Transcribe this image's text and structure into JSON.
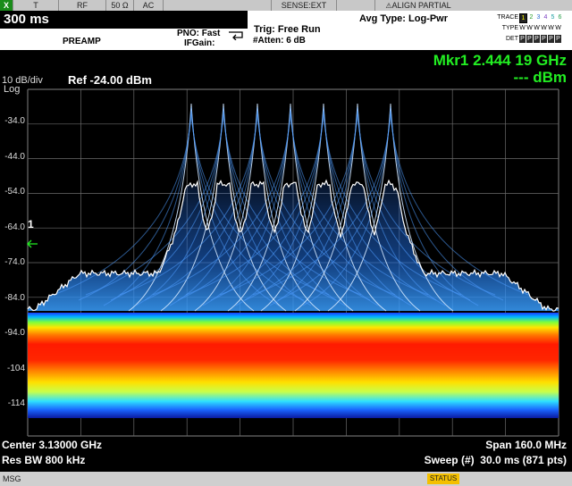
{
  "statusbar": {
    "x_label": "X",
    "t_label": "T",
    "rf_label": "RF",
    "impedance": "50 Ω",
    "coupling": "AC",
    "sense": "SENSE:EXT",
    "align": "ALIGN PARTIAL"
  },
  "header": {
    "sweep_time": "300 ms",
    "preamp": "PREAMP",
    "pno": "PNO: Fast",
    "ifgain": "IFGain:",
    "trig": "Trig: Free Run",
    "atten": "#Atten: 6 dB",
    "avg_type": "Avg Type: Log-Pwr"
  },
  "trace_panel": {
    "trace_label": "TRACE",
    "type_label": "TYPE",
    "det_label": "DET",
    "traces": [
      "1",
      "2",
      "3",
      "4",
      "5",
      "6"
    ],
    "types": [
      "W",
      "W",
      "W",
      "W",
      "W",
      "W"
    ],
    "dets": [
      "P",
      "P",
      "P",
      "P",
      "P",
      "P"
    ]
  },
  "display": {
    "scale": "10 dB/div",
    "scale_type": "Log",
    "ref_level": "Ref -24.00 dBm",
    "marker_freq": "Mkr1 2.444 19 GHz",
    "marker_amp": "--- dBm",
    "marker_number": "1",
    "y_ticks": [
      "-34.0",
      "-44.0",
      "-54.0",
      "-64.0",
      "-74.0",
      "-84.0",
      "-94.0",
      "-104",
      "-114"
    ]
  },
  "footer": {
    "center": "Center 3.13000 GHz",
    "rbw": "Res BW 800 kHz",
    "span": "Span 160.0 MHz",
    "sweep": "Sweep (#)  30.0 ms (871 pts)"
  },
  "msgbar": {
    "msg_label": "MSG",
    "status_label": "STATUS"
  },
  "colors": {
    "marker_green": "#22ee22",
    "trace_white": "#ffffff",
    "density_blue": "#1f6ee0"
  }
}
